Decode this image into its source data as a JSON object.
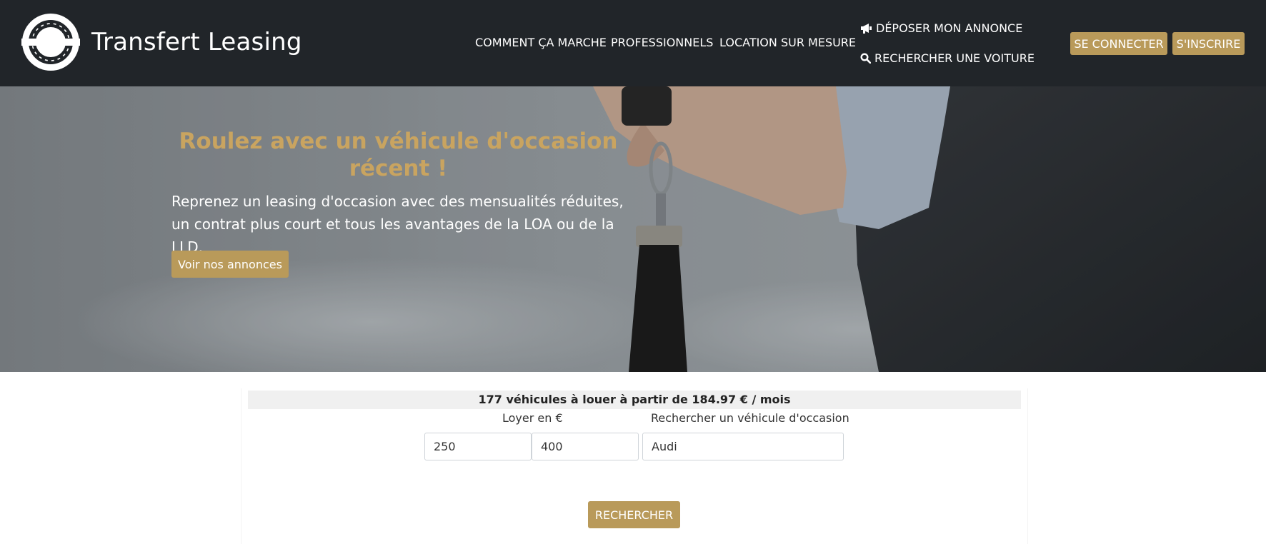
{
  "colors": {
    "navbar": "#212529",
    "gold": "#b99a5a",
    "hero_title": "#c9a460"
  },
  "header": {
    "brand_name": "Transfert Leasing",
    "nav": {
      "how_it_works": "COMMENT ÇA MARCHE",
      "professionals": "PROFESSIONNELS",
      "custom_rental": "LOCATION SUR MESURE",
      "post_ad": "DÉPOSER MON ANNONCE",
      "search_car": "RECHERCHER UNE VOITURE"
    },
    "login_label": "SE CONNECTER",
    "signup_label": "S'INSCRIRE",
    "icons": {
      "post_ad": "megaphone-icon",
      "search_car": "search-icon",
      "logo": "circular-road-logo-icon"
    }
  },
  "hero": {
    "title": "Roulez avec un véhicule d'occasion récent !",
    "subtitle": "Reprenez un leasing d'occasion avec des mensualités réduites, un contrat plus court et tous les avantages de la LOA ou de la LLD.",
    "cta_label": "Voir nos annonces"
  },
  "search": {
    "count_text": "177 véhicules à louer à partir de 184.97 € / mois",
    "rent_label": "Loyer en €",
    "rent_min_value": "250",
    "rent_max_value": "400",
    "vehicle_label": "Rechercher un véhicule d'occasion",
    "vehicle_value": "Audi",
    "submit_label": "RECHERCHER"
  }
}
